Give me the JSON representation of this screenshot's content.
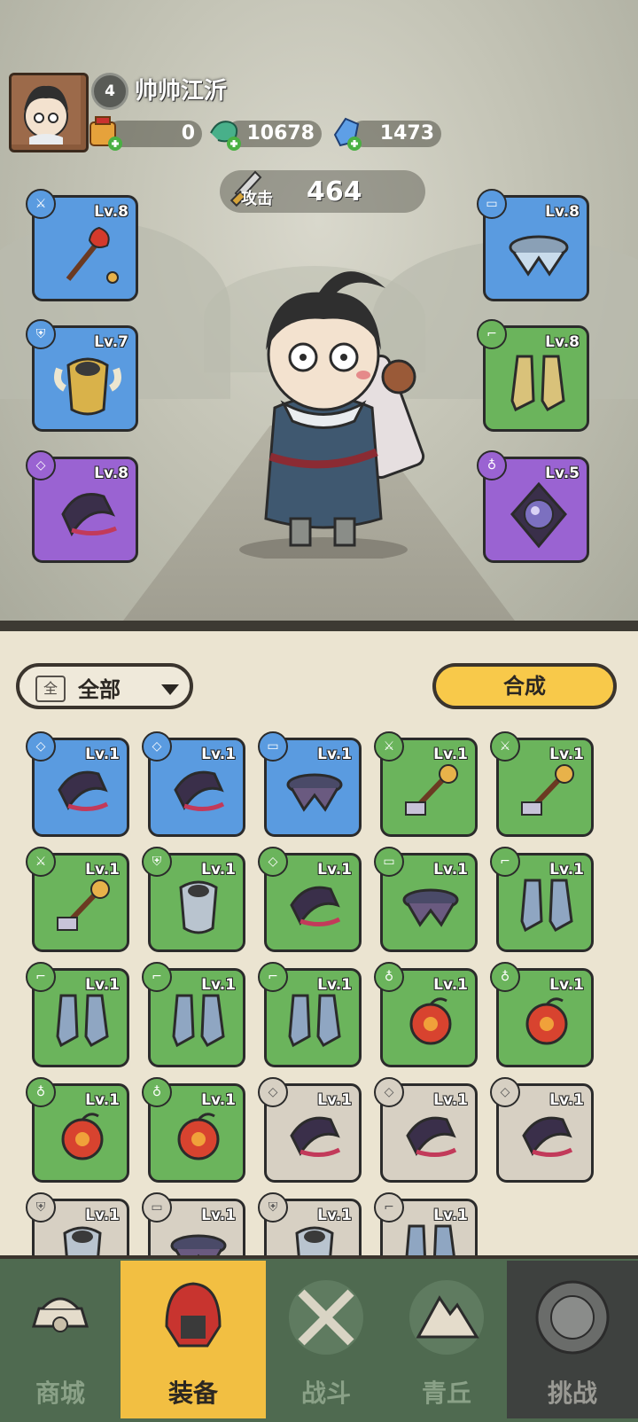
{
  "player": {
    "level": "4",
    "name": "帅帅江沂"
  },
  "resources": {
    "tokens": "0",
    "jade": "10678",
    "crystals": "1473"
  },
  "power": {
    "label": "攻击",
    "value": "464"
  },
  "equipped": {
    "weapon": {
      "level": "Lv.8",
      "rarity": "blue",
      "icon": "sword-icon"
    },
    "armor": {
      "level": "Lv.7",
      "rarity": "blue",
      "icon": "armor-icon"
    },
    "ring": {
      "level": "Lv.8",
      "rarity": "purple",
      "icon": "ring-icon"
    },
    "belt": {
      "level": "Lv.8",
      "rarity": "blue",
      "icon": "belt-icon"
    },
    "boots": {
      "level": "Lv.8",
      "rarity": "green",
      "icon": "boots-icon"
    },
    "amulet": {
      "level": "Lv.5",
      "rarity": "purple",
      "icon": "amulet-icon"
    }
  },
  "filter": {
    "icon_char": "全",
    "label": "全部"
  },
  "merge_label": "合成",
  "inventory": [
    {
      "level": "Lv.1",
      "rarity": "blue",
      "slot": "ring-icon"
    },
    {
      "level": "Lv.1",
      "rarity": "blue",
      "slot": "ring-icon"
    },
    {
      "level": "Lv.1",
      "rarity": "blue",
      "slot": "belt-icon"
    },
    {
      "level": "Lv.1",
      "rarity": "green",
      "slot": "sword-icon"
    },
    {
      "level": "Lv.1",
      "rarity": "green",
      "slot": "sword-icon"
    },
    {
      "level": "Lv.1",
      "rarity": "green",
      "slot": "sword-icon"
    },
    {
      "level": "Lv.1",
      "rarity": "green",
      "slot": "armor-icon"
    },
    {
      "level": "Lv.1",
      "rarity": "green",
      "slot": "ring-icon"
    },
    {
      "level": "Lv.1",
      "rarity": "green",
      "slot": "belt-icon"
    },
    {
      "level": "Lv.1",
      "rarity": "green",
      "slot": "boots-icon"
    },
    {
      "level": "Lv.1",
      "rarity": "green",
      "slot": "boots-icon"
    },
    {
      "level": "Lv.1",
      "rarity": "green",
      "slot": "boots-icon"
    },
    {
      "level": "Lv.1",
      "rarity": "green",
      "slot": "boots-icon"
    },
    {
      "level": "Lv.1",
      "rarity": "green",
      "slot": "amulet-icon"
    },
    {
      "level": "Lv.1",
      "rarity": "green",
      "slot": "amulet-icon"
    },
    {
      "level": "Lv.1",
      "rarity": "green",
      "slot": "amulet-icon"
    },
    {
      "level": "Lv.1",
      "rarity": "green",
      "slot": "amulet-icon"
    },
    {
      "level": "Lv.1",
      "rarity": "gray",
      "slot": "ring-icon"
    },
    {
      "level": "Lv.1",
      "rarity": "gray",
      "slot": "ring-icon"
    },
    {
      "level": "Lv.1",
      "rarity": "gray",
      "slot": "ring-icon"
    },
    {
      "level": "Lv.1",
      "rarity": "gray",
      "slot": "armor-icon"
    },
    {
      "level": "Lv.1",
      "rarity": "gray",
      "slot": "belt-icon"
    },
    {
      "level": "Lv.1",
      "rarity": "gray",
      "slot": "armor-icon"
    },
    {
      "level": "Lv.1",
      "rarity": "gray",
      "slot": "boots-icon"
    }
  ],
  "nav": [
    {
      "label": "商城",
      "icon": "shop-icon",
      "state": "normal"
    },
    {
      "label": "装备",
      "icon": "helmet-icon",
      "state": "active"
    },
    {
      "label": "战斗",
      "icon": "crossed-swords-icon",
      "state": "normal"
    },
    {
      "label": "青丘",
      "icon": "mountain-icon",
      "state": "normal"
    },
    {
      "label": "挑战",
      "icon": "challenge-icon",
      "state": "locked"
    }
  ],
  "colors": {
    "blue": "#5a9be0",
    "green": "#6bb45c",
    "purple": "#9a63d2",
    "gray": "#d7d0c3",
    "accent": "#f8c94a",
    "nav_bg": "#4f6a50"
  }
}
